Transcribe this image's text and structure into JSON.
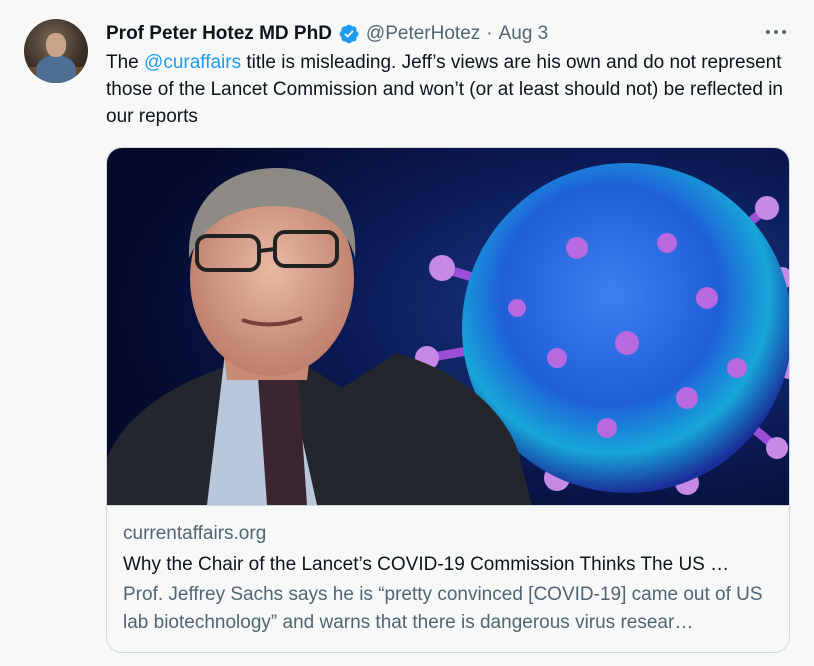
{
  "tweet": {
    "author_name": "Prof Peter Hotez MD PhD",
    "handle": "@PeterHotez",
    "separator": "·",
    "date": "Aug 3",
    "text_before": "The ",
    "mention": "@curaffairs",
    "text_after": " title is misleading. Jeff’s views are his own and do not represent those of the Lancet Commission and won’t (or at least should not) be reflected in our reports"
  },
  "card": {
    "domain": "currentaffairs.org",
    "title": "Why the Chair of the Lancet’s COVID-19 Commission Thinks The US …",
    "description": "Prof. Jeffrey Sachs says he is “pretty convinced [COVID-19] came out of US lab biotechnology” and warns that there is dangerous virus resear…"
  },
  "colors": {
    "accent": "#1d9bf0",
    "secondary_text": "#536471",
    "background": "#f7f9f9"
  },
  "icons": {
    "verified": "verified-badge-icon",
    "more": "more-options-icon"
  }
}
